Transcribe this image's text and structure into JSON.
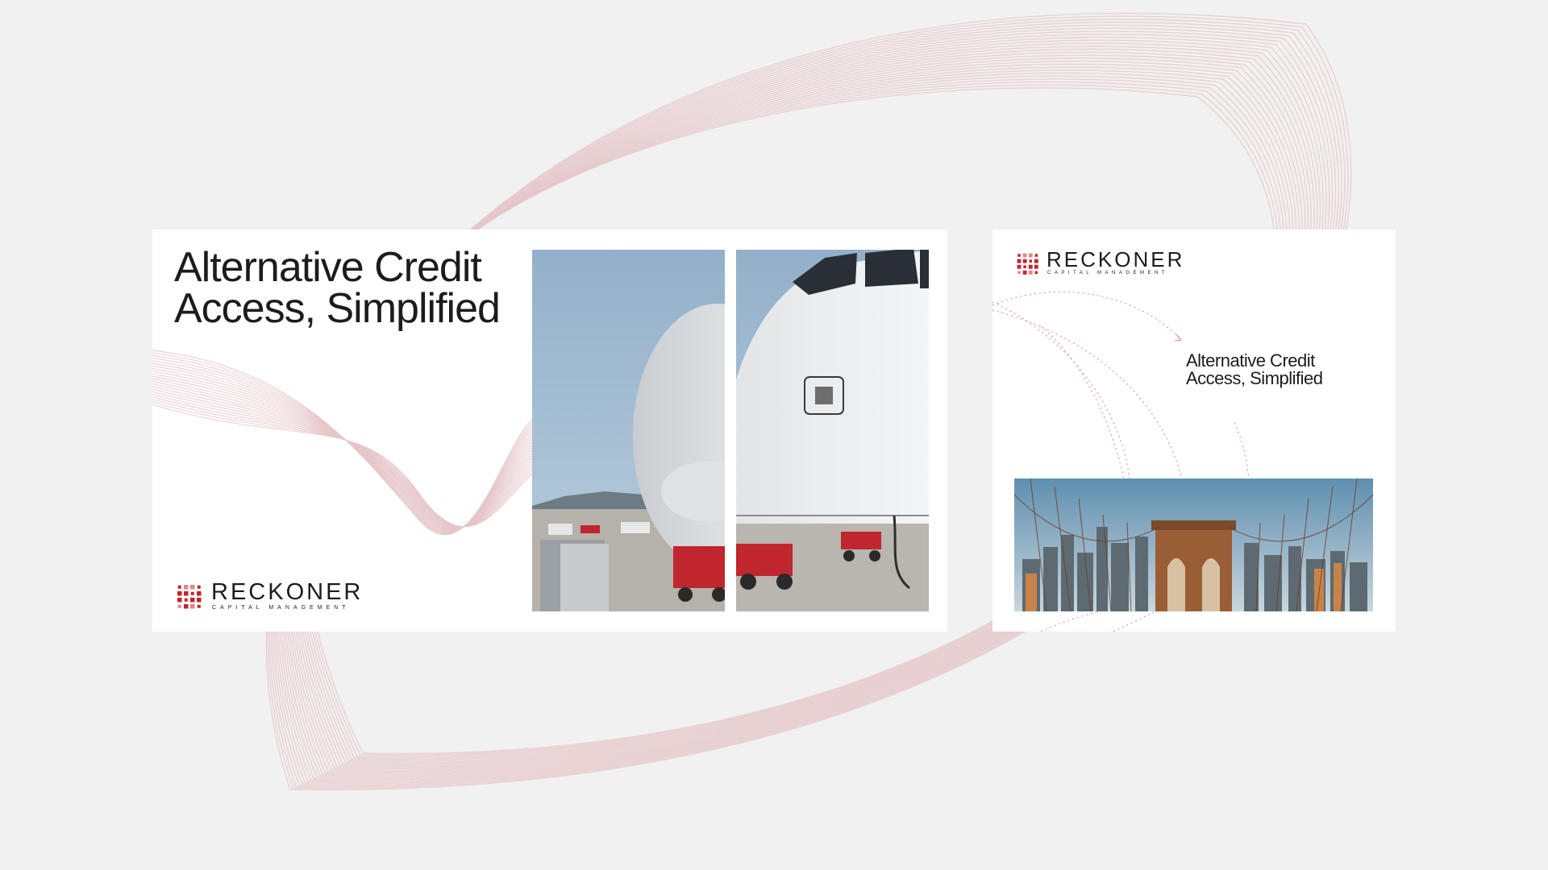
{
  "page": {
    "background_color": "#f1f1f1",
    "accent_color": "#c0262d",
    "swirl_color": "#e6c6c8"
  },
  "banner_wide": {
    "headline": "Alternative Credit Access, Simplified",
    "photo": "airport-apron-airplane-nose-photo",
    "logo": {
      "wordmark": "RECKONER",
      "tagline": "CAPITAL MANAGEMENT"
    }
  },
  "banner_square": {
    "headline": "Alternative Credit Access, Simplified",
    "photo": "brooklyn-bridge-skyline-photo",
    "logo": {
      "wordmark": "RECKONER",
      "tagline": "CAPITAL MANAGEMENT"
    }
  }
}
